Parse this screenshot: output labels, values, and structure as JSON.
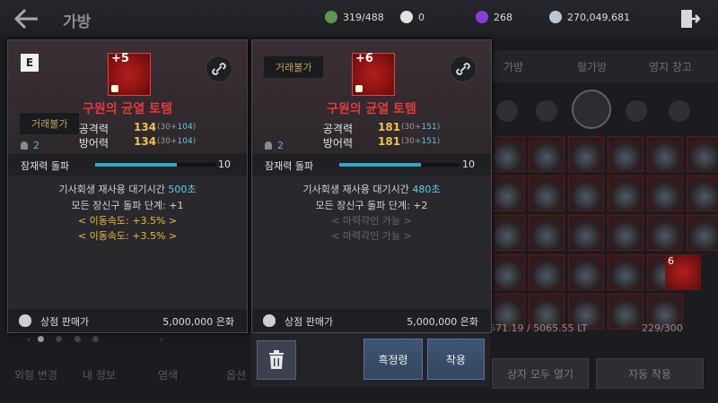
{
  "header": {
    "title": "가방",
    "resources": [
      {
        "icon": "green-coin-icon",
        "value": "319/488",
        "color": "#5a9a48"
      },
      {
        "icon": "pearl-icon",
        "value": "0",
        "color": "#e6e0e0"
      },
      {
        "icon": "purple-gem-icon",
        "value": "268",
        "color": "#8a3fd4"
      },
      {
        "icon": "silver-coin-icon",
        "value": "270,049,681",
        "color": "#b9c6d6"
      }
    ]
  },
  "background": {
    "tabs": [
      "가방",
      "펄가방",
      "영지 창고"
    ],
    "weight": "571.19 / 5065.55 LT",
    "slots": "229/300",
    "open_all_button": "상자 모두 열기",
    "auto_equip_button": "자동 착용",
    "bottom_tabs": [
      "외형 변경",
      "내 정보",
      "염색",
      "옵션"
    ],
    "cell_enhancement": "6"
  },
  "cards": [
    {
      "grade": "E",
      "trade": "거래불가",
      "enhancement": "+5",
      "name": "구원의 균열 토템",
      "attack_label": "공격력",
      "attack": "134",
      "attack_base": "(30+",
      "attack_bonus": "104",
      "attack_end": ")",
      "defense_label": "방어력",
      "defense": "134",
      "defense_base": "(30+",
      "defense_bonus": "104",
      "defense_end": ")",
      "stack": "2",
      "awaken_label": "잠재력 돌파",
      "awaken_value": "10",
      "awaken_fill_fraction": 0.68,
      "cooldown_text": "기사회생 재사용 대기시간 ",
      "cooldown_value": "500초",
      "breakthrough": "모든 장신구 돌파 단계: +1",
      "extra_lines": [
        "< 이동속도: +3.5% >",
        "< 이동속도: +3.5% >"
      ],
      "sell_label": "상점 판매가",
      "sell_price": "5,000,000 은화"
    },
    {
      "trade": "거래불가",
      "enhancement": "+6",
      "name": "구원의 균열 토템",
      "attack_label": "공격력",
      "attack": "181",
      "attack_base": "(30+",
      "attack_bonus": "151",
      "attack_end": ")",
      "defense_label": "방어력",
      "defense": "181",
      "defense_base": "(30+",
      "defense_bonus": "151",
      "defense_end": ")",
      "stack": "2",
      "awaken_label": "잠재력 돌파",
      "awaken_value": "10",
      "awaken_fill_fraction": 0.68,
      "cooldown_text": "기사회생 재사용 대기시간 ",
      "cooldown_value": "480초",
      "breakthrough": "모든 장신구 돌파 단계: +2",
      "extra_lines": [
        "< 마력각인 가능 >",
        "< 마력각인 가능 >"
      ],
      "sell_label": "상점 판매가",
      "sell_price": "5,000,000 은화"
    }
  ],
  "actions": {
    "black_spirit": "흑정령",
    "equip": "착용"
  }
}
